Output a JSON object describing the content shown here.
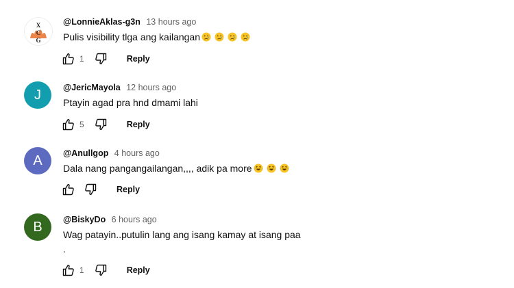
{
  "comments": [
    {
      "author": "@LonnieAklas-g3n",
      "time": "13 hours ago",
      "text": "Pulis visibility tlga ang kailangan",
      "emoji": "sad-face-emoji",
      "emoji_count": 4,
      "likes": "1",
      "reply_label": "Reply",
      "avatar_letter": "",
      "avatar_color": "#ffffff"
    },
    {
      "author": "@JericMayola",
      "time": "12 hours ago",
      "text": "Ptayin agad pra hnd dmami lahi",
      "likes": "5",
      "reply_label": "Reply",
      "avatar_letter": "J",
      "avatar_color": "#129eaf"
    },
    {
      "author": "@Anullgop",
      "time": "4 hours ago",
      "text": "Dala nang pangangailangan,,,, adik pa more",
      "emoji": "laughing-tears-emoji",
      "emoji_count": 3,
      "likes": "",
      "reply_label": "Reply",
      "avatar_letter": "A",
      "avatar_color": "#5c6bc0"
    },
    {
      "author": "@BiskyDo",
      "time": "6 hours ago",
      "text": "Wag patayin..putulin lang ang isang kamay at isang paa",
      "extra_line": ".",
      "likes": "1",
      "reply_label": "Reply",
      "avatar_letter": "B",
      "avatar_color": "#33691e"
    }
  ]
}
